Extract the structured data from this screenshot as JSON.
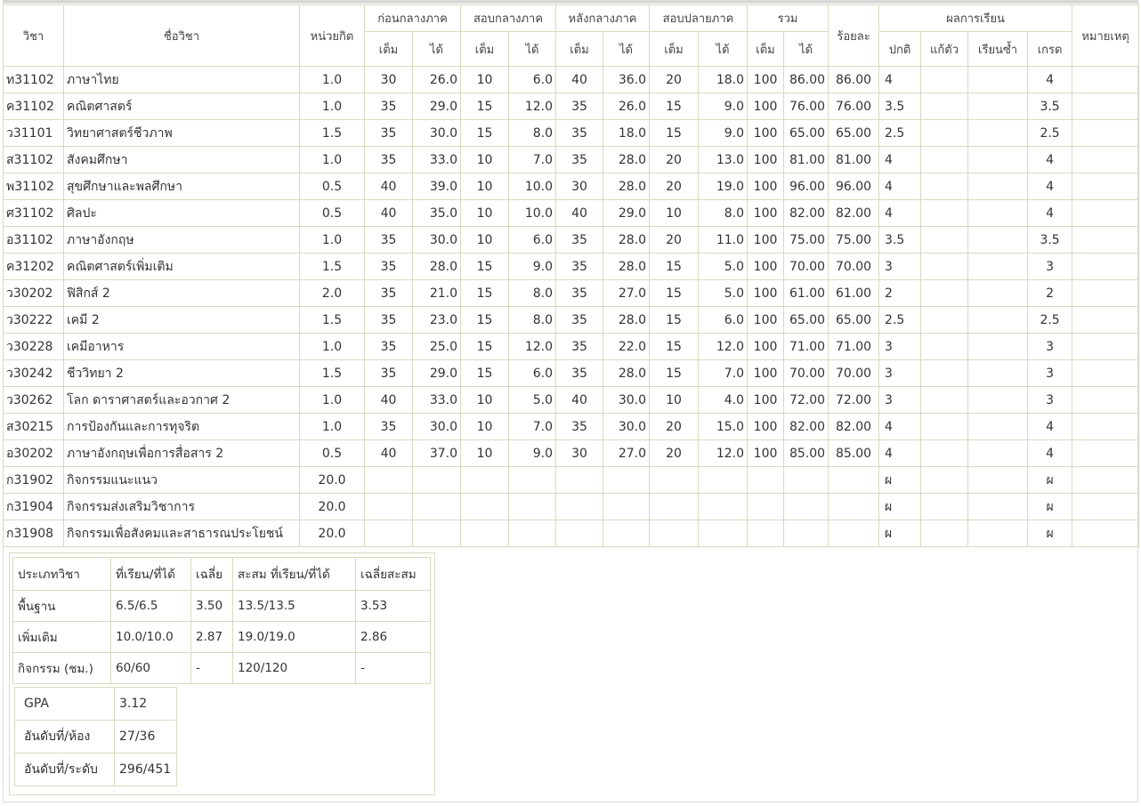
{
  "header": {
    "subject_code": "วิชา",
    "subject_name": "ชื่อวิชา",
    "credit": "หน่วยกิต",
    "before_midterm": "ก่อนกลางภาค",
    "midterm_exam": "สอบกลางภาค",
    "after_midterm": "หลังกลางภาค",
    "final_exam": "สอบปลายภาค",
    "total": "รวม",
    "percent": "ร้อยละ",
    "result": "ผลการเรียน",
    "remark": "หมายเหตุ",
    "full": "เต็ม",
    "got": "ได้",
    "normal": "ปกติ",
    "fix": "แก้ตัว",
    "repeat": "เรียนซ้ำ",
    "grade": "เกรด"
  },
  "rows": [
    {
      "code": "ท31102",
      "name": "ภาษาไทย",
      "credit": "1.0",
      "bf": "30",
      "bg": "26.0",
      "mf": "10",
      "mg": "6.0",
      "af": "40",
      "ag": "36.0",
      "ff": "20",
      "fg": "18.0",
      "tf": "100",
      "tg": "86.00",
      "pct": "86.00",
      "normal": "4",
      "fix": "",
      "repeat": "",
      "grade": "4",
      "remark": ""
    },
    {
      "code": "ค31102",
      "name": "คณิตศาสตร์",
      "credit": "1.0",
      "bf": "35",
      "bg": "29.0",
      "mf": "15",
      "mg": "12.0",
      "af": "35",
      "ag": "26.0",
      "ff": "15",
      "fg": "9.0",
      "tf": "100",
      "tg": "76.00",
      "pct": "76.00",
      "normal": "3.5",
      "fix": "",
      "repeat": "",
      "grade": "3.5",
      "remark": ""
    },
    {
      "code": "ว31101",
      "name": "วิทยาศาสตร์ชีวภาพ",
      "credit": "1.5",
      "bf": "35",
      "bg": "30.0",
      "mf": "15",
      "mg": "8.0",
      "af": "35",
      "ag": "18.0",
      "ff": "15",
      "fg": "9.0",
      "tf": "100",
      "tg": "65.00",
      "pct": "65.00",
      "normal": "2.5",
      "fix": "",
      "repeat": "",
      "grade": "2.5",
      "remark": ""
    },
    {
      "code": "ส31102",
      "name": "สังคมศึกษา",
      "credit": "1.0",
      "bf": "35",
      "bg": "33.0",
      "mf": "10",
      "mg": "7.0",
      "af": "35",
      "ag": "28.0",
      "ff": "20",
      "fg": "13.0",
      "tf": "100",
      "tg": "81.00",
      "pct": "81.00",
      "normal": "4",
      "fix": "",
      "repeat": "",
      "grade": "4",
      "remark": ""
    },
    {
      "code": "พ31102",
      "name": "สุขศึกษาและพลศึกษา",
      "credit": "0.5",
      "bf": "40",
      "bg": "39.0",
      "mf": "10",
      "mg": "10.0",
      "af": "30",
      "ag": "28.0",
      "ff": "20",
      "fg": "19.0",
      "tf": "100",
      "tg": "96.00",
      "pct": "96.00",
      "normal": "4",
      "fix": "",
      "repeat": "",
      "grade": "4",
      "remark": ""
    },
    {
      "code": "ศ31102",
      "name": "ศิลปะ",
      "credit": "0.5",
      "bf": "40",
      "bg": "35.0",
      "mf": "10",
      "mg": "10.0",
      "af": "40",
      "ag": "29.0",
      "ff": "10",
      "fg": "8.0",
      "tf": "100",
      "tg": "82.00",
      "pct": "82.00",
      "normal": "4",
      "fix": "",
      "repeat": "",
      "grade": "4",
      "remark": ""
    },
    {
      "code": "อ31102",
      "name": "ภาษาอังกฤษ",
      "credit": "1.0",
      "bf": "35",
      "bg": "30.0",
      "mf": "10",
      "mg": "6.0",
      "af": "35",
      "ag": "28.0",
      "ff": "20",
      "fg": "11.0",
      "tf": "100",
      "tg": "75.00",
      "pct": "75.00",
      "normal": "3.5",
      "fix": "",
      "repeat": "",
      "grade": "3.5",
      "remark": ""
    },
    {
      "code": "ค31202",
      "name": "คณิตศาสตร์เพิ่มเติม",
      "credit": "1.5",
      "bf": "35",
      "bg": "28.0",
      "mf": "15",
      "mg": "9.0",
      "af": "35",
      "ag": "28.0",
      "ff": "15",
      "fg": "5.0",
      "tf": "100",
      "tg": "70.00",
      "pct": "70.00",
      "normal": "3",
      "fix": "",
      "repeat": "",
      "grade": "3",
      "remark": ""
    },
    {
      "code": "ว30202",
      "name": "ฟิสิกส์ 2",
      "credit": "2.0",
      "bf": "35",
      "bg": "21.0",
      "mf": "15",
      "mg": "8.0",
      "af": "35",
      "ag": "27.0",
      "ff": "15",
      "fg": "5.0",
      "tf": "100",
      "tg": "61.00",
      "pct": "61.00",
      "normal": "2",
      "fix": "",
      "repeat": "",
      "grade": "2",
      "remark": ""
    },
    {
      "code": "ว30222",
      "name": "เคมี 2",
      "credit": "1.5",
      "bf": "35",
      "bg": "23.0",
      "mf": "15",
      "mg": "8.0",
      "af": "35",
      "ag": "28.0",
      "ff": "15",
      "fg": "6.0",
      "tf": "100",
      "tg": "65.00",
      "pct": "65.00",
      "normal": "2.5",
      "fix": "",
      "repeat": "",
      "grade": "2.5",
      "remark": ""
    },
    {
      "code": "ว30228",
      "name": "เคมีอาหาร",
      "credit": "1.0",
      "bf": "35",
      "bg": "25.0",
      "mf": "15",
      "mg": "12.0",
      "af": "35",
      "ag": "22.0",
      "ff": "15",
      "fg": "12.0",
      "tf": "100",
      "tg": "71.00",
      "pct": "71.00",
      "normal": "3",
      "fix": "",
      "repeat": "",
      "grade": "3",
      "remark": ""
    },
    {
      "code": "ว30242",
      "name": "ชีววิทยา 2",
      "credit": "1.5",
      "bf": "35",
      "bg": "29.0",
      "mf": "15",
      "mg": "6.0",
      "af": "35",
      "ag": "28.0",
      "ff": "15",
      "fg": "7.0",
      "tf": "100",
      "tg": "70.00",
      "pct": "70.00",
      "normal": "3",
      "fix": "",
      "repeat": "",
      "grade": "3",
      "remark": ""
    },
    {
      "code": "ว30262",
      "name": "โลก ดาราศาสตร์และอวกาศ 2",
      "credit": "1.0",
      "bf": "40",
      "bg": "33.0",
      "mf": "10",
      "mg": "5.0",
      "af": "40",
      "ag": "30.0",
      "ff": "10",
      "fg": "4.0",
      "tf": "100",
      "tg": "72.00",
      "pct": "72.00",
      "normal": "3",
      "fix": "",
      "repeat": "",
      "grade": "3",
      "remark": ""
    },
    {
      "code": "ส30215",
      "name": "การป้องกันและการทุจริต",
      "credit": "1.0",
      "bf": "35",
      "bg": "30.0",
      "mf": "10",
      "mg": "7.0",
      "af": "35",
      "ag": "30.0",
      "ff": "20",
      "fg": "15.0",
      "tf": "100",
      "tg": "82.00",
      "pct": "82.00",
      "normal": "4",
      "fix": "",
      "repeat": "",
      "grade": "4",
      "remark": ""
    },
    {
      "code": "อ30202",
      "name": "ภาษาอังกฤษเพื่อการสื่อสาร 2",
      "credit": "0.5",
      "bf": "40",
      "bg": "37.0",
      "mf": "10",
      "mg": "9.0",
      "af": "30",
      "ag": "27.0",
      "ff": "20",
      "fg": "12.0",
      "tf": "100",
      "tg": "85.00",
      "pct": "85.00",
      "normal": "4",
      "fix": "",
      "repeat": "",
      "grade": "4",
      "remark": ""
    },
    {
      "code": "ก31902",
      "name": "กิจกรรมแนะแนว",
      "credit": "20.0",
      "bf": "",
      "bg": "",
      "mf": "",
      "mg": "",
      "af": "",
      "ag": "",
      "ff": "",
      "fg": "",
      "tf": "",
      "tg": "",
      "pct": "",
      "normal": "ผ",
      "fix": "",
      "repeat": "",
      "grade": "ผ",
      "remark": ""
    },
    {
      "code": "ก31904",
      "name": "กิจกรรมส่งเสริมวิชาการ",
      "credit": "20.0",
      "bf": "",
      "bg": "",
      "mf": "",
      "mg": "",
      "af": "",
      "ag": "",
      "ff": "",
      "fg": "",
      "tf": "",
      "tg": "",
      "pct": "",
      "normal": "ผ",
      "fix": "",
      "repeat": "",
      "grade": "ผ",
      "remark": ""
    },
    {
      "code": "ก31908",
      "name": "กิจกรรมเพื่อสังคมและสาธารณประโยชน์",
      "credit": "20.0",
      "bf": "",
      "bg": "",
      "mf": "",
      "mg": "",
      "af": "",
      "ag": "",
      "ff": "",
      "fg": "",
      "tf": "",
      "tg": "",
      "pct": "",
      "normal": "ผ",
      "fix": "",
      "repeat": "",
      "grade": "ผ",
      "remark": ""
    }
  ],
  "summary": {
    "header": {
      "type": "ประเภทวิชา",
      "studied": "ที่เรียน/ที่ได้",
      "avg": "เฉลี่ย",
      "cumulative": "สะสม ที่เรียน/ที่ได้",
      "cum_avg": "เฉลี่ยสะสม"
    },
    "rows": [
      {
        "type": "พื้นฐาน",
        "studied": "6.5/6.5",
        "avg": "3.50",
        "cumulative": "13.5/13.5",
        "cum_avg": "3.53"
      },
      {
        "type": "เพิ่มเติม",
        "studied": "10.0/10.0",
        "avg": "2.87",
        "cumulative": "19.0/19.0",
        "cum_avg": "2.86"
      },
      {
        "type": "กิจกรรม (ชม.)",
        "studied": "60/60",
        "avg": "-",
        "cumulative": "120/120",
        "cum_avg": "-"
      }
    ],
    "gpa_label": "GPA",
    "gpa_value": "3.12",
    "class_rank_label": "อันดับที่/ห้อง",
    "class_rank_value": "27/36",
    "level_rank_label": "อันดับที่/ระดับ",
    "level_rank_value": "296/451"
  }
}
